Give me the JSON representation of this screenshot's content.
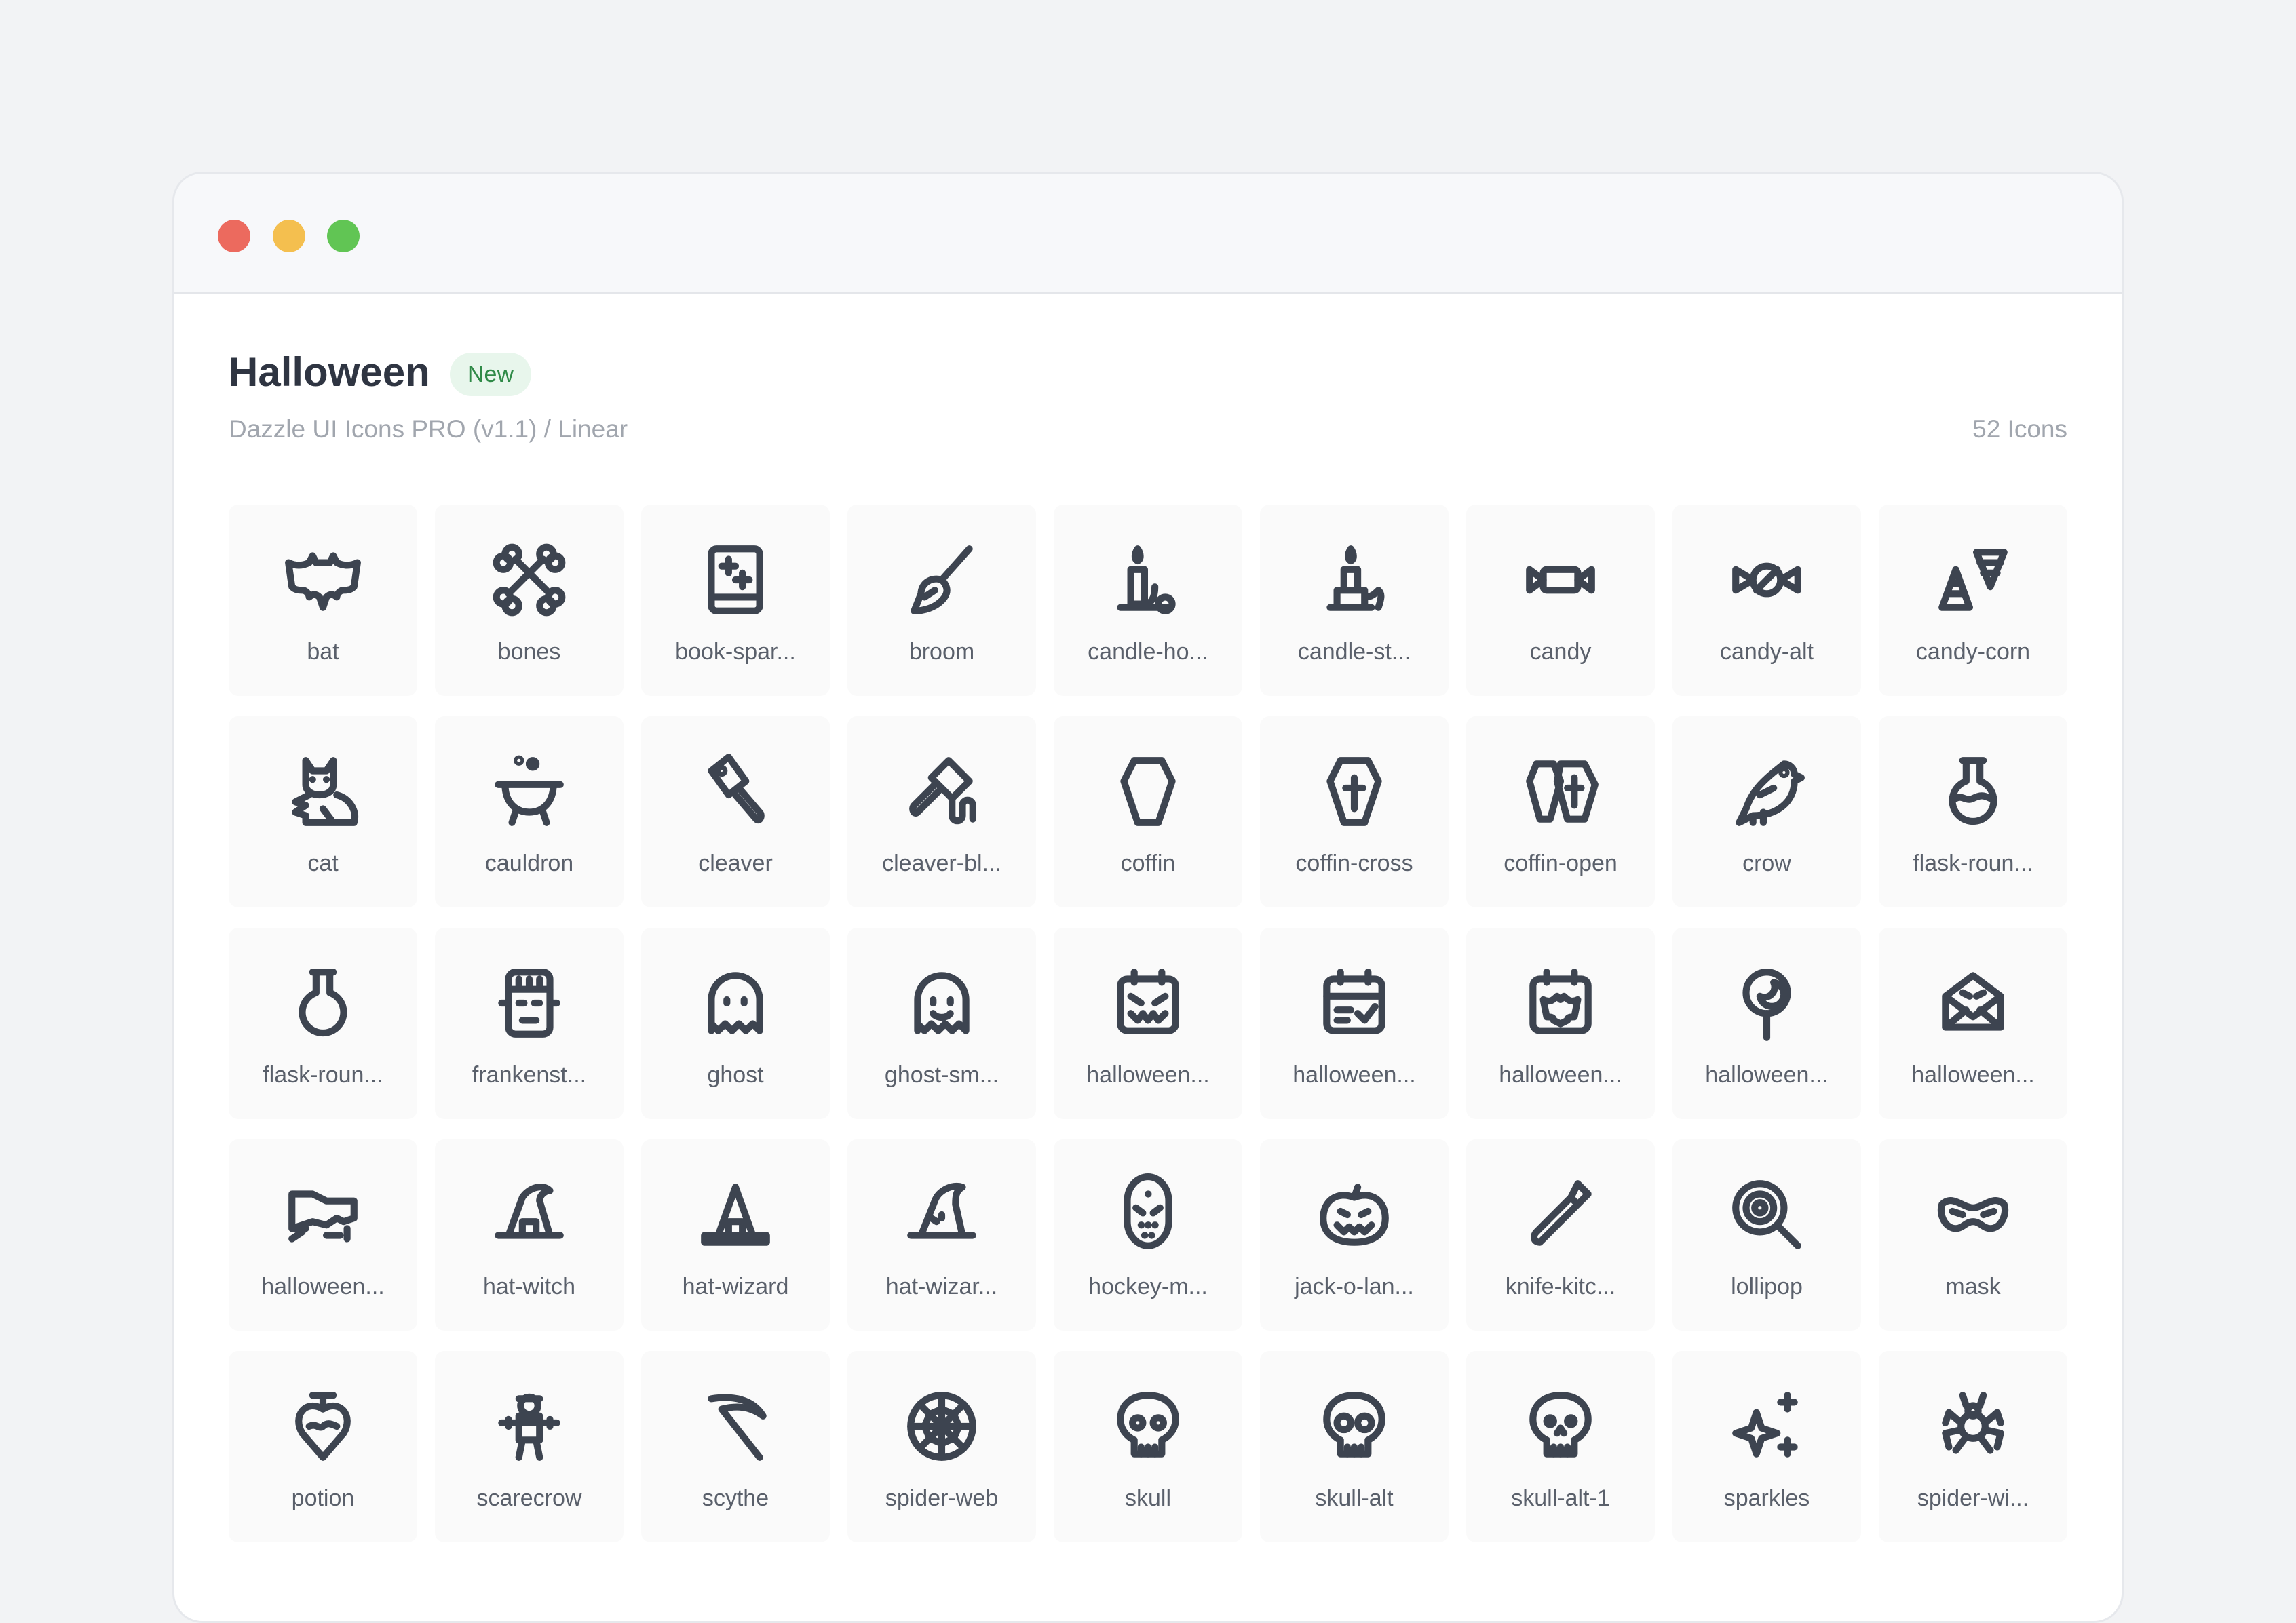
{
  "header": {
    "title": "Halloween",
    "badge": "New",
    "subtitle": "Dazzle UI Icons PRO (v1.1) / Linear",
    "count": "52 Icons"
  },
  "colors": {
    "icon": "#3d4450",
    "badge_bg": "#e8f6ec",
    "badge_text": "#2f8a47",
    "close": "#ec6a5e",
    "minimize": "#f4bf4f",
    "maximize": "#61c554"
  },
  "icons": [
    {
      "label": "bat",
      "icon": "bat-icon"
    },
    {
      "label": "bones",
      "icon": "bones-icon"
    },
    {
      "label": "book-spar...",
      "icon": "book-sparkles-icon"
    },
    {
      "label": "broom",
      "icon": "broom-icon"
    },
    {
      "label": "candle-ho...",
      "icon": "candle-holder-icon"
    },
    {
      "label": "candle-st...",
      "icon": "candle-stand-icon"
    },
    {
      "label": "candy",
      "icon": "candy-icon"
    },
    {
      "label": "candy-alt",
      "icon": "candy-alt-icon"
    },
    {
      "label": "candy-corn",
      "icon": "candy-corn-icon"
    },
    {
      "label": "cat",
      "icon": "cat-icon"
    },
    {
      "label": "cauldron",
      "icon": "cauldron-icon"
    },
    {
      "label": "cleaver",
      "icon": "cleaver-icon"
    },
    {
      "label": "cleaver-bl...",
      "icon": "cleaver-blood-icon"
    },
    {
      "label": "coffin",
      "icon": "coffin-icon"
    },
    {
      "label": "coffin-cross",
      "icon": "coffin-cross-icon"
    },
    {
      "label": "coffin-open",
      "icon": "coffin-open-icon"
    },
    {
      "label": "crow",
      "icon": "crow-icon"
    },
    {
      "label": "flask-roun...",
      "icon": "flask-round-potion-icon"
    },
    {
      "label": "flask-roun...",
      "icon": "flask-round-icon"
    },
    {
      "label": "frankenst...",
      "icon": "frankenstein-icon"
    },
    {
      "label": "ghost",
      "icon": "ghost-icon"
    },
    {
      "label": "ghost-sm...",
      "icon": "ghost-smile-icon"
    },
    {
      "label": "halloween...",
      "icon": "halloween-calendar-face-icon"
    },
    {
      "label": "halloween...",
      "icon": "halloween-calendar-check-icon"
    },
    {
      "label": "halloween...",
      "icon": "halloween-calendar-bat-icon"
    },
    {
      "label": "halloween...",
      "icon": "halloween-lollipop-moon-icon"
    },
    {
      "label": "halloween...",
      "icon": "halloween-envelope-icon"
    },
    {
      "label": "halloween...",
      "icon": "halloween-tombstone-icon"
    },
    {
      "label": "hat-witch",
      "icon": "hat-witch-icon"
    },
    {
      "label": "hat-wizard",
      "icon": "hat-wizard-icon"
    },
    {
      "label": "hat-wizar...",
      "icon": "hat-wizard-alt-icon"
    },
    {
      "label": "hockey-m...",
      "icon": "hockey-mask-icon"
    },
    {
      "label": "jack-o-lan...",
      "icon": "jack-o-lantern-icon"
    },
    {
      "label": "knife-kitc...",
      "icon": "knife-kitchen-icon"
    },
    {
      "label": "lollipop",
      "icon": "lollipop-icon"
    },
    {
      "label": "mask",
      "icon": "mask-icon"
    },
    {
      "label": "potion",
      "icon": "potion-icon"
    },
    {
      "label": "scarecrow",
      "icon": "scarecrow-icon"
    },
    {
      "label": "scythe",
      "icon": "scythe-icon"
    },
    {
      "label": "spider-web",
      "icon": "spider-web-icon"
    },
    {
      "label": "skull",
      "icon": "skull-icon"
    },
    {
      "label": "skull-alt",
      "icon": "skull-alt-icon"
    },
    {
      "label": "skull-alt-1",
      "icon": "skull-alt-1-icon"
    },
    {
      "label": "sparkles",
      "icon": "sparkles-icon"
    },
    {
      "label": "spider-wi...",
      "icon": "spider-web-alt-icon"
    }
  ]
}
